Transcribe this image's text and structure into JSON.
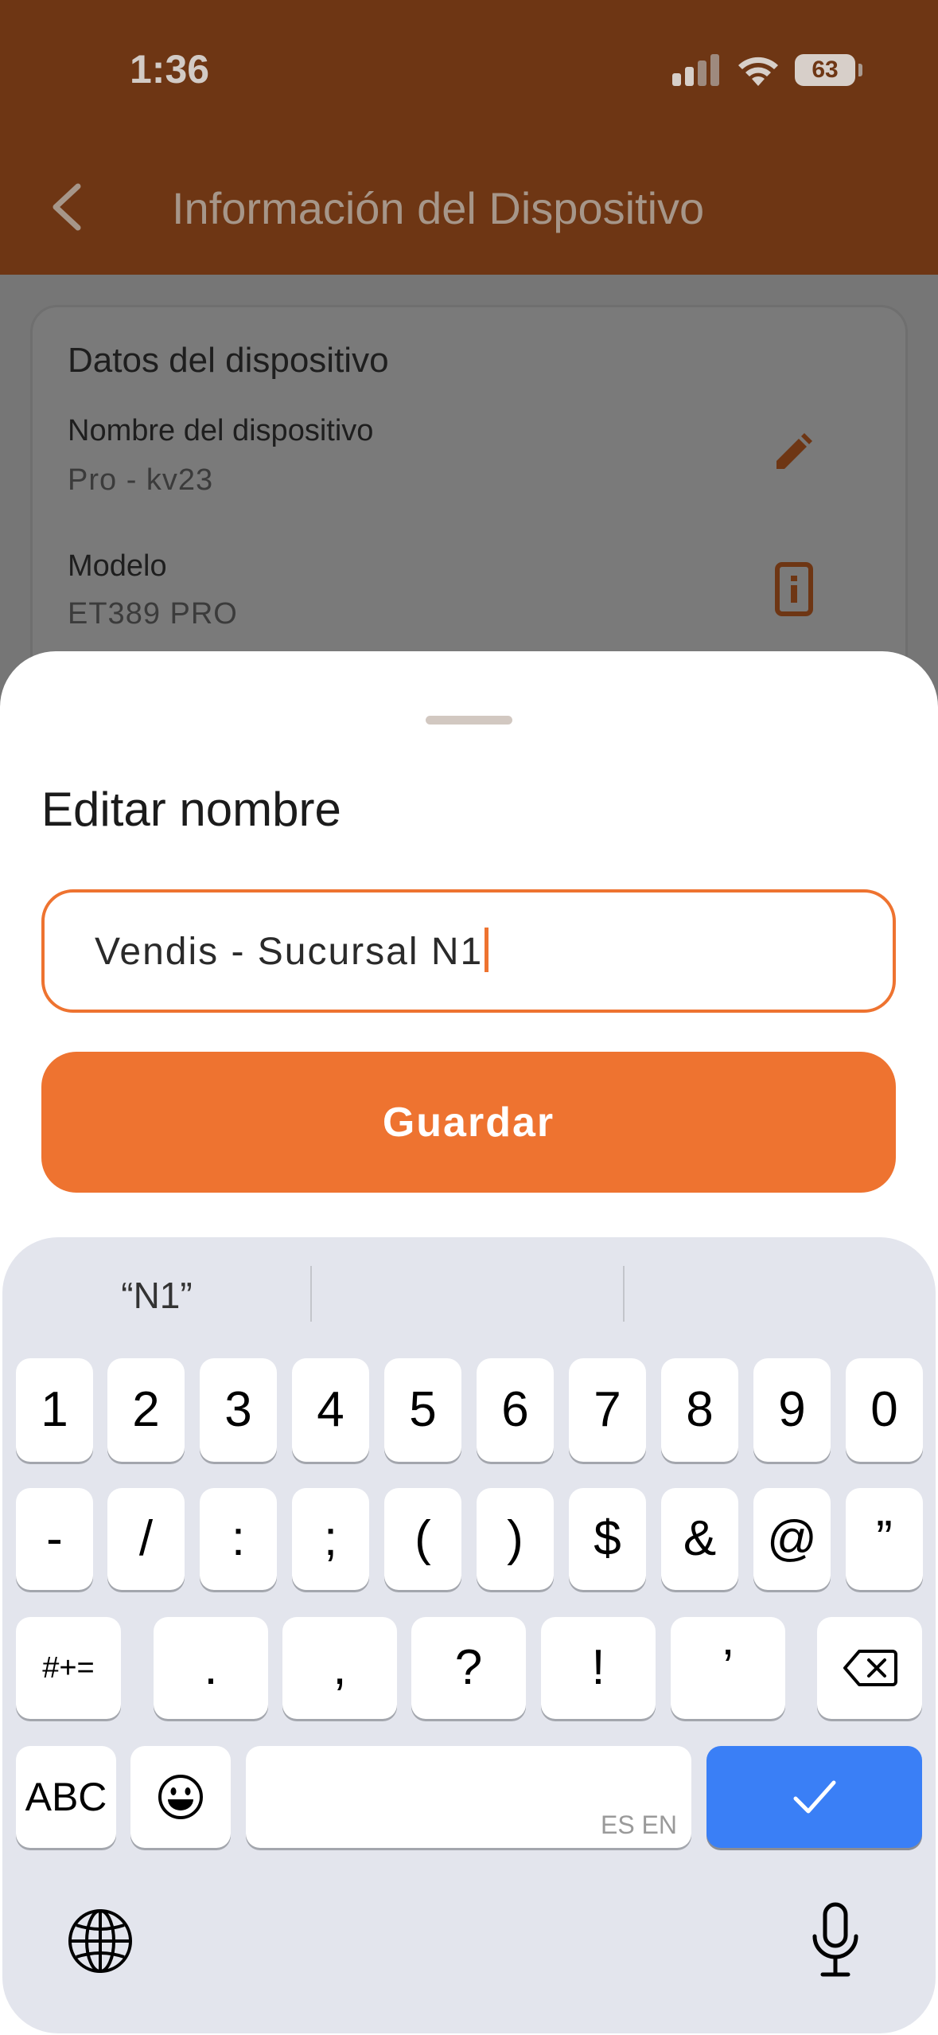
{
  "status_bar": {
    "time": "1:36",
    "battery": "63"
  },
  "header": {
    "title": "Información del Dispositivo"
  },
  "card": {
    "title": "Datos del dispositivo",
    "fields": [
      {
        "label": "Nombre del dispositivo",
        "value": "Pro - kv23",
        "icon": "pencil-icon"
      },
      {
        "label": "Modelo",
        "value": "ET389 PRO",
        "icon": "info-icon"
      }
    ]
  },
  "sheet": {
    "title": "Editar nombre",
    "input_value": "Vendis - Sucursal N1",
    "save_label": "Guardar"
  },
  "keyboard": {
    "suggestions": [
      "“N1”",
      "",
      ""
    ],
    "row1": [
      "1",
      "2",
      "3",
      "4",
      "5",
      "6",
      "7",
      "8",
      "9",
      "0"
    ],
    "row2": [
      "-",
      "/",
      ":",
      ";",
      "(",
      ")",
      "$",
      "&",
      "@",
      "”"
    ],
    "row3": {
      "mode": "#+=",
      "keys": [
        ".",
        ",",
        "?",
        "!",
        "’"
      ]
    },
    "row4": {
      "abc": "ABC",
      "space_hint": "ES EN"
    }
  },
  "colors": {
    "brand": "#6e3614",
    "accent": "#ee7330",
    "return": "#3a7ff6"
  }
}
